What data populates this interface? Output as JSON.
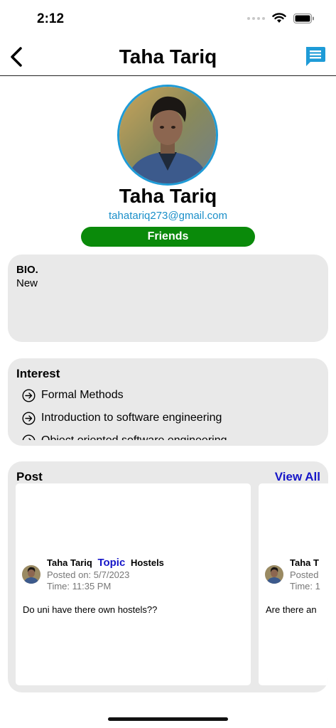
{
  "status_bar": {
    "time": "2:12"
  },
  "nav": {
    "title": "Taha Tariq"
  },
  "profile": {
    "name": "Taha Tariq",
    "email": "tahatariq273@gmail.com",
    "status": "Friends"
  },
  "bio": {
    "heading": "BIO.",
    "text": "New"
  },
  "interest": {
    "heading": "Interest",
    "items": [
      "Formal Methods",
      "Introduction to software engineering",
      "Object oriented software engineering"
    ]
  },
  "posts": {
    "heading": "Post",
    "view_all": "View All",
    "items": [
      {
        "author": "Taha Tariq",
        "topic_label": "Topic",
        "topic": "Hostels",
        "date": "Posted on: 5/7/2023",
        "time": "Time: 11:35 PM",
        "text": "Do uni have there own hostels??"
      },
      {
        "author": "Taha T",
        "date": "Posted",
        "time": "Time: 1",
        "text": "Are there an"
      }
    ]
  },
  "colors": {
    "accent": "#1e9bd7",
    "friends_badge": "#0a8a0a",
    "link": "#1515c8",
    "card_bg": "#e9e9e9"
  }
}
